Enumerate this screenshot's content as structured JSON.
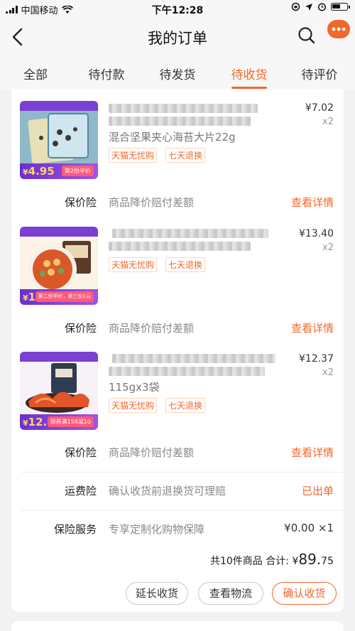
{
  "status_bar": {
    "carrier": "中国移动",
    "time": "下午12:28"
  },
  "header": {
    "title": "我的订单"
  },
  "tabs": [
    {
      "label": "全部",
      "active": false
    },
    {
      "label": "待付款",
      "active": false
    },
    {
      "label": "待发货",
      "active": false
    },
    {
      "label": "待收货",
      "active": true
    },
    {
      "label": "待评价",
      "active": false
    }
  ],
  "colors": {
    "accent": "#f2672a",
    "badge_purple": "#7b3fd1"
  },
  "order": {
    "items": [
      {
        "subtitle": "混合坚果夹心海苔大片22g",
        "price": "¥7.02",
        "qty": "x2",
        "badges": [
          "天猫无忧购",
          "七天退换"
        ],
        "thumb_price": "4.95",
        "thumb_promo": "第2份半价",
        "protection": {
          "label": "保价险",
          "desc": "商品降价赔付差额",
          "link": "查看详情"
        }
      },
      {
        "subtitle": "",
        "price": "¥13.40",
        "qty": "x2",
        "badges": [
          "天猫无忧购",
          "七天退换"
        ],
        "thumb_price": "1",
        "thumb_promo": "第二份半价，第三份1元",
        "protection": {
          "label": "保价险",
          "desc": "商品降价赔付差额",
          "link": "查看详情"
        }
      },
      {
        "subtitle": "115gx3袋",
        "price": "¥12.37",
        "qty": "x2",
        "badges": [
          "天猫无忧购",
          "七天退换"
        ],
        "thumb_price": "12.9",
        "thumb_promo": "领券满158减10",
        "protection": {
          "label": "保价险",
          "desc": "商品降价赔付差额",
          "link": "查看详情"
        }
      }
    ],
    "shipping_insurance": {
      "label": "运费险",
      "desc": "确认收货前退换货可理赔",
      "status": "已出单"
    },
    "insurance_service": {
      "label": "保险服务",
      "desc": "专享定制化购物保障",
      "value": "¥0.00 ×1"
    },
    "summary": {
      "count_text": "共10件商品",
      "total_label": "合计:",
      "currency": "¥",
      "total_int": "89.",
      "total_dec": "75"
    },
    "actions": {
      "extend": "延长收货",
      "logistics": "查看物流",
      "confirm": "确认收货"
    }
  }
}
